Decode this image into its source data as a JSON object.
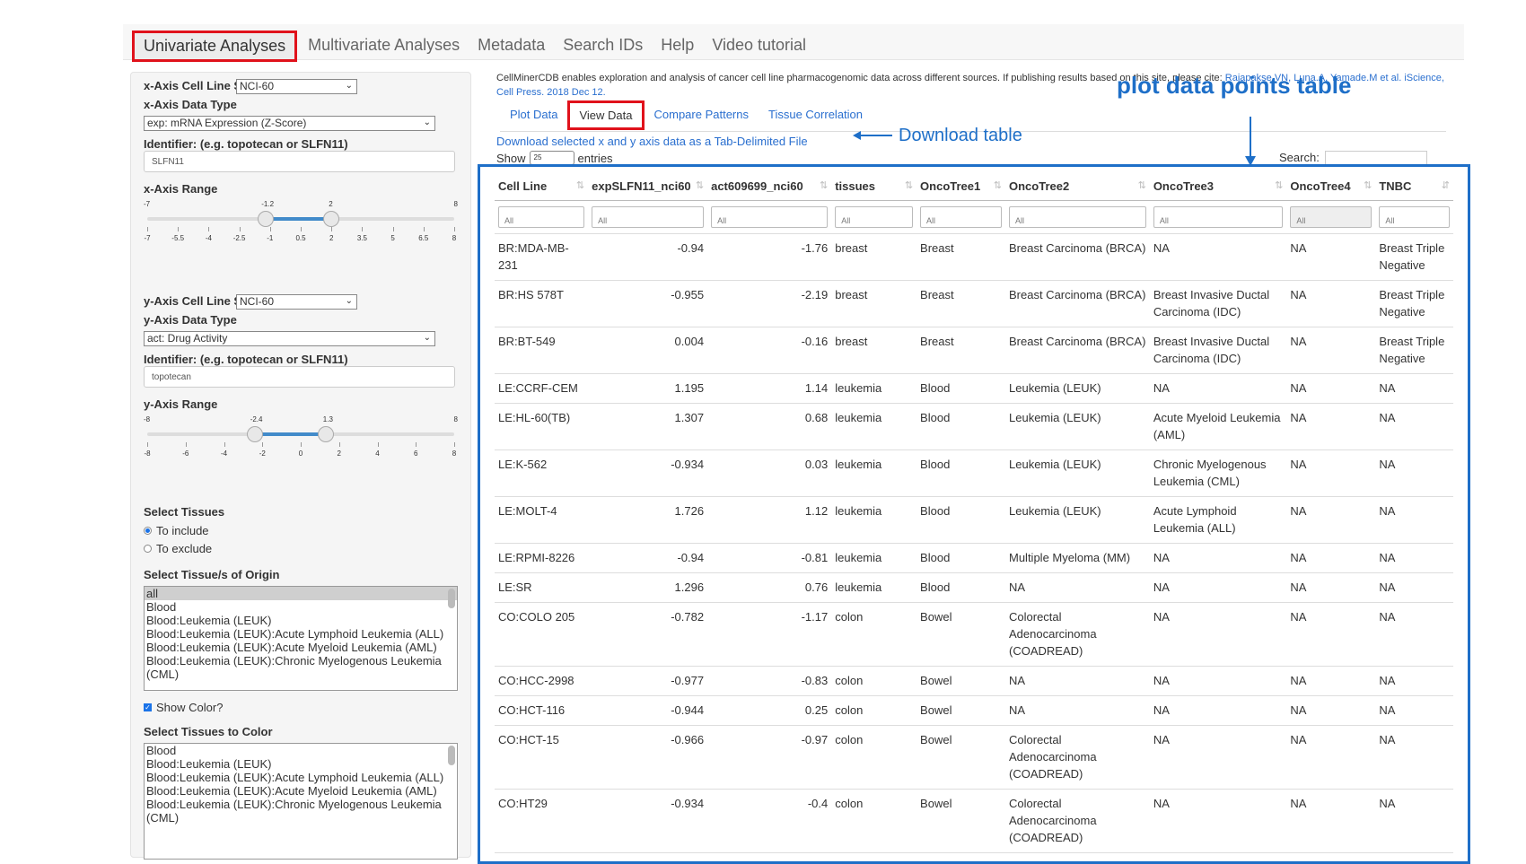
{
  "nav": {
    "tabs": [
      "Univariate Analyses",
      "Multivariate Analyses",
      "Metadata",
      "Search IDs",
      "Help",
      "Video tutorial"
    ],
    "active": "Univariate Analyses"
  },
  "sidebar": {
    "x_set_label": "x-Axis Cell Line Set",
    "x_set_value": "NCI-60",
    "x_type_label": "x-Axis Data Type",
    "x_type_value": "exp: mRNA Expression (Z-Score)",
    "x_id_label": "Identifier: (e.g. topotecan or SLFN11)",
    "x_id_value": "SLFN11",
    "x_range_label": "x-Axis Range",
    "x_range": {
      "min": "-7",
      "max": "8",
      "low": "-1.2",
      "high": "2",
      "low_val": -1.2,
      "high_val": 2,
      "ticks": [
        "-7",
        "-5.5",
        "-4",
        "-2.5",
        "-1",
        "0.5",
        "2",
        "3.5",
        "5",
        "6.5",
        "8"
      ]
    },
    "y_set_label": "y-Axis Cell Line Set",
    "y_set_value": "NCI-60",
    "y_type_label": "y-Axis Data Type",
    "y_type_value": "act: Drug Activity",
    "y_id_label": "Identifier: (e.g. topotecan or SLFN11)",
    "y_id_value": "topotecan",
    "y_range_label": "y-Axis Range",
    "y_range": {
      "min": "-8",
      "max": "8",
      "low": "-2.4",
      "high": "1.3",
      "low_val": -2.4,
      "high_val": 1.3,
      "ticks": [
        "-8",
        "-6",
        "-4",
        "-2",
        "0",
        "2",
        "4",
        "6",
        "8"
      ]
    },
    "select_tissues_label": "Select Tissues",
    "radio_include": "To include",
    "radio_exclude": "To exclude",
    "origin_label": "Select Tissue/s of Origin",
    "origin_items": [
      "all",
      "Blood",
      "Blood:Leukemia (LEUK)",
      "Blood:Leukemia (LEUK):Acute Lymphoid Leukemia (ALL)",
      "Blood:Leukemia (LEUK):Acute Myeloid Leukemia (AML)",
      "Blood:Leukemia (LEUK):Chronic Myelogenous Leukemia (CML)"
    ],
    "show_color_label": "Show Color?",
    "color_label": "Select Tissues to Color",
    "color_items": [
      "Blood",
      "Blood:Leukemia (LEUK)",
      "Blood:Leukemia (LEUK):Acute Lymphoid Leukemia (ALL)",
      "Blood:Leukemia (LEUK):Acute Myeloid Leukemia (AML)",
      "Blood:Leukemia (LEUK):Chronic Myelogenous Leukemia (CML)"
    ]
  },
  "main": {
    "intro_text": "CellMinerCDB enables exploration and analysis of cancer cell line pharmacogenomic data across different sources. If publishing results based on this site, please cite: ",
    "intro_link": "Rajapakse.VN, Luna.A, Yamade.M et al. iScience, Cell Press. 2018 Dec 12.",
    "subtabs": [
      "Plot Data",
      "View Data",
      "Compare Patterns",
      "Tissue Correlation"
    ],
    "active_subtab": "View Data",
    "download_link": "Download selected x and y axis data as a Tab-Delimited File",
    "show_label": "Show",
    "show_value": "25",
    "entries_label": "entries",
    "search_label": "Search:",
    "annotation_download": "Download table",
    "annotation_table": "plot data points table",
    "filter_placeholder": "All"
  },
  "table": {
    "headers": [
      "Cell Line",
      "expSLFN11_nci60",
      "act609699_nci60",
      "tissues",
      "OncoTree1",
      "OncoTree2",
      "OncoTree3",
      "OncoTree4",
      "TNBC"
    ],
    "rows": [
      [
        "BR:MDA-MB-231",
        "-0.94",
        "-1.76",
        "breast",
        "Breast",
        "Breast Carcinoma (BRCA)",
        "NA",
        "NA",
        "Breast Triple Negative"
      ],
      [
        "BR:HS 578T",
        "-0.955",
        "-2.19",
        "breast",
        "Breast",
        "Breast Carcinoma (BRCA)",
        "Breast Invasive Ductal Carcinoma (IDC)",
        "NA",
        "Breast Triple Negative"
      ],
      [
        "BR:BT-549",
        "0.004",
        "-0.16",
        "breast",
        "Breast",
        "Breast Carcinoma (BRCA)",
        "Breast Invasive Ductal Carcinoma (IDC)",
        "NA",
        "Breast Triple Negative"
      ],
      [
        "LE:CCRF-CEM",
        "1.195",
        "1.14",
        "leukemia",
        "Blood",
        "Leukemia (LEUK)",
        "NA",
        "NA",
        "NA"
      ],
      [
        "LE:HL-60(TB)",
        "1.307",
        "0.68",
        "leukemia",
        "Blood",
        "Leukemia (LEUK)",
        "Acute Myeloid Leukemia (AML)",
        "NA",
        "NA"
      ],
      [
        "LE:K-562",
        "-0.934",
        "0.03",
        "leukemia",
        "Blood",
        "Leukemia (LEUK)",
        "Chronic Myelogenous Leukemia (CML)",
        "NA",
        "NA"
      ],
      [
        "LE:MOLT-4",
        "1.726",
        "1.12",
        "leukemia",
        "Blood",
        "Leukemia (LEUK)",
        "Acute Lymphoid Leukemia (ALL)",
        "NA",
        "NA"
      ],
      [
        "LE:RPMI-8226",
        "-0.94",
        "-0.81",
        "leukemia",
        "Blood",
        "Multiple Myeloma (MM)",
        "NA",
        "NA",
        "NA"
      ],
      [
        "LE:SR",
        "1.296",
        "0.76",
        "leukemia",
        "Blood",
        "NA",
        "NA",
        "NA",
        "NA"
      ],
      [
        "CO:COLO 205",
        "-0.782",
        "-1.17",
        "colon",
        "Bowel",
        "Colorectal Adenocarcinoma (COADREAD)",
        "NA",
        "NA",
        "NA"
      ],
      [
        "CO:HCC-2998",
        "-0.977",
        "-0.83",
        "colon",
        "Bowel",
        "NA",
        "NA",
        "NA",
        "NA"
      ],
      [
        "CO:HCT-116",
        "-0.944",
        "0.25",
        "colon",
        "Bowel",
        "NA",
        "NA",
        "NA",
        "NA"
      ],
      [
        "CO:HCT-15",
        "-0.966",
        "-0.97",
        "colon",
        "Bowel",
        "Colorectal Adenocarcinoma (COADREAD)",
        "NA",
        "NA",
        "NA"
      ],
      [
        "CO:HT29",
        "-0.934",
        "-0.4",
        "colon",
        "Bowel",
        "Colorectal Adenocarcinoma (COADREAD)",
        "NA",
        "NA",
        "NA"
      ]
    ]
  }
}
